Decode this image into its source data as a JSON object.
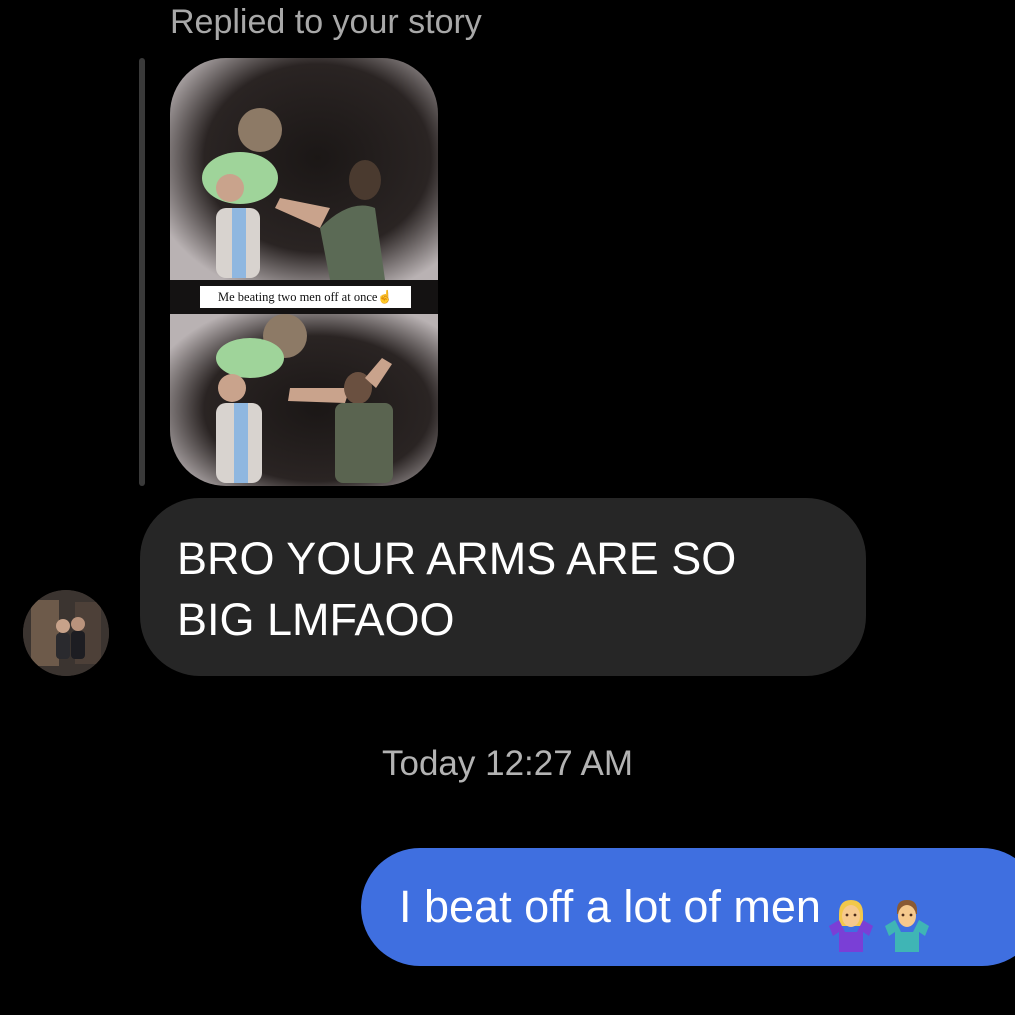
{
  "reply": {
    "label": "Replied to your story",
    "story_caption": "Me beating two men off at once☝️"
  },
  "incoming_message": {
    "text": "BRO YOUR ARMS ARE SO BIG LMFAOO"
  },
  "timestamp": "Today 12:27 AM",
  "outgoing_message": {
    "text": "I beat off a lot of men",
    "emojis": [
      "woman-shrugging-icon",
      "man-shrugging-icon"
    ]
  },
  "colors": {
    "background": "#000000",
    "incoming_bubble": "#262626",
    "outgoing_bubble": "#3f6fe0",
    "secondary_text": "#a8a8a8"
  }
}
